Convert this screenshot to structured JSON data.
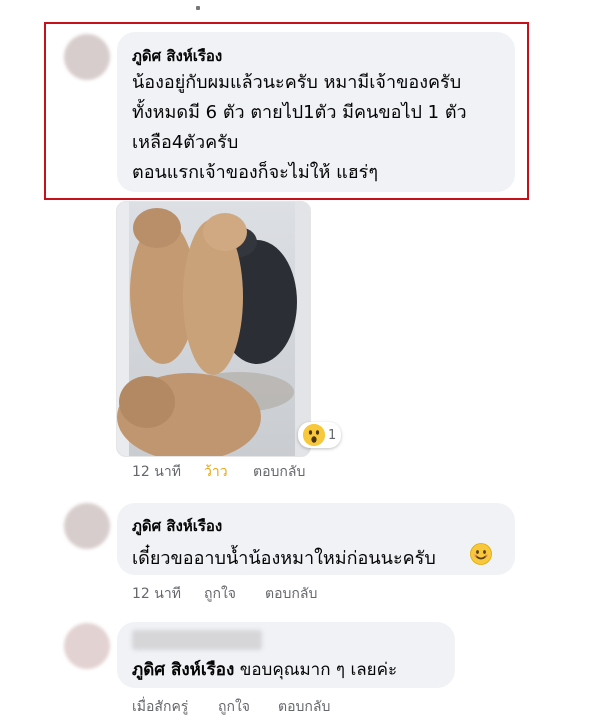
{
  "comments": [
    {
      "author": "ภูดิศ สิงห์เรือง",
      "lines": [
        "น้องอยู่กับผมแล้วนะครับ  หมามีเจ้าของครับ",
        "ทั้งหมดมี 6 ตัว ตายไป1ตัว   มีคนขอไป 1 ตัว",
        "เหลือ4ตัวครับ",
        "ตอนแรกเจ้าของก็จะไม่ให้  แฮร่ๆ"
      ],
      "photo_reaction": {
        "icon": "wow-emoji-icon",
        "count": "1"
      },
      "time": "12 นาที",
      "reaction_label": "ว้าว",
      "reply_label": "ตอบกลับ"
    },
    {
      "author": "ภูดิศ สิงห์เรือง",
      "text": "เดี๋ยวขออาบน้ำน้องหมาใหม่ก่อนนะครับ",
      "emoji": "smile-emoji-icon",
      "time": "12 นาที",
      "like_label": "ถูกใจ",
      "reply_label": "ตอบกลับ"
    },
    {
      "mention": "ภูดิศ สิงห์เรือง",
      "text": "ขอบคุณมาก ๆ เลยค่ะ",
      "time": "เมื่อสักครู่",
      "like_label": "ถูกใจ",
      "reply_label": "ตอบกลับ"
    }
  ],
  "colors": {
    "highlight": "#c8101c",
    "wow": "#f7c83b",
    "bubble": "#f0f2f5",
    "meta": "#65676b",
    "active_reaction": "#e8a613"
  }
}
